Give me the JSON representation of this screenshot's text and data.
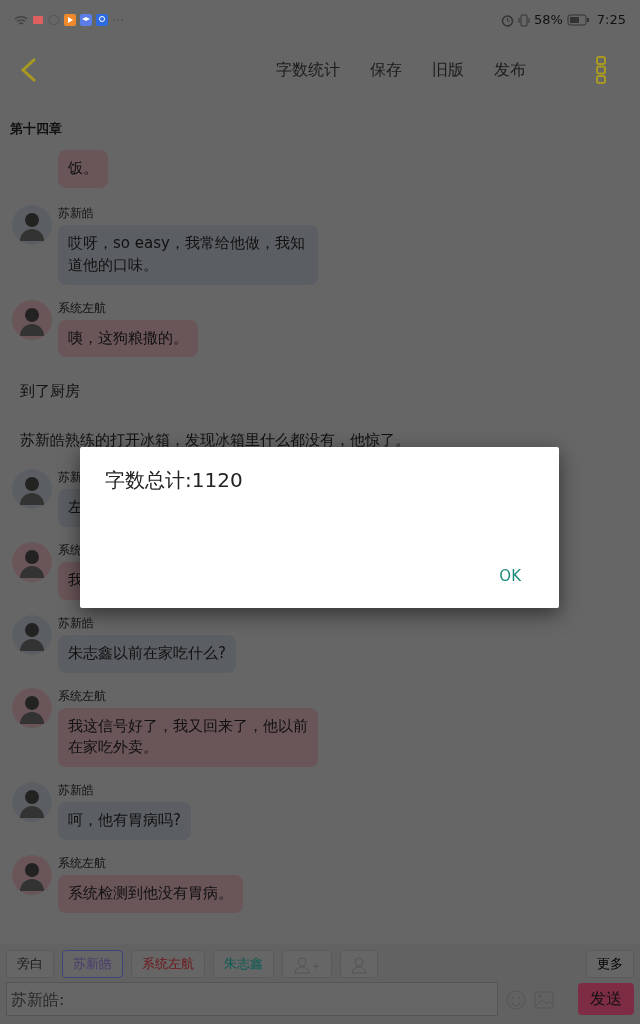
{
  "status_bar": {
    "battery": "58%",
    "time": "7:25"
  },
  "toolbar": {
    "actions": [
      "字数统计",
      "保存",
      "旧版",
      "发布"
    ]
  },
  "chapter_title": "第十四章",
  "messages": [
    {
      "kind": "message",
      "color": "#6a5558",
      "text": "饭。"
    },
    {
      "kind": "message",
      "speaker": "苏新皓",
      "color": "#5b5f63",
      "text": "哎呀，so easy，我常给他做，我知道他的口味。"
    },
    {
      "kind": "message",
      "speaker": "系统左航",
      "color": "#6a5558",
      "text": "咦，这狗粮撒的。"
    },
    {
      "kind": "narration",
      "text": "到了厨房"
    },
    {
      "kind": "narration",
      "text": "苏新皓熟练的打开冰箱，发现冰箱里什么都没有，他惊了。"
    },
    {
      "kind": "message",
      "speaker": "苏新",
      "color": "#5b5f63",
      "text": "左"
    },
    {
      "kind": "message",
      "speaker": "系统",
      "color": "#6a5558",
      "text": "我"
    },
    {
      "kind": "message",
      "speaker": "苏新皓",
      "color": "#5b5f63",
      "text": "朱志鑫以前在家吃什么?"
    },
    {
      "kind": "message",
      "speaker": "系统左航",
      "color": "#6a5558",
      "text": "我这信号好了，我又回来了，他以前在家吃外卖。"
    },
    {
      "kind": "message",
      "speaker": "苏新皓",
      "color": "#5b5f63",
      "text": "呵，他有胃病吗?"
    },
    {
      "kind": "message",
      "speaker": "系统左航",
      "color": "#6a5558",
      "text": "系统检测到他没有胃病。"
    }
  ],
  "speakers": [
    {
      "label": "旁白",
      "selected": false,
      "color": "#1a1a1a"
    },
    {
      "label": "苏新皓",
      "selected": true,
      "color": "#4a3a6e"
    },
    {
      "label": "系统左航",
      "selected": false,
      "color": "#6e161b"
    },
    {
      "label": "朱志鑫",
      "selected": false,
      "color": "#0c5c54"
    }
  ],
  "more_button": "更多",
  "input": {
    "placeholder": "苏新皓:"
  },
  "send_button": "发送",
  "dialog": {
    "message": "字数总计:1120",
    "button": "OK"
  }
}
